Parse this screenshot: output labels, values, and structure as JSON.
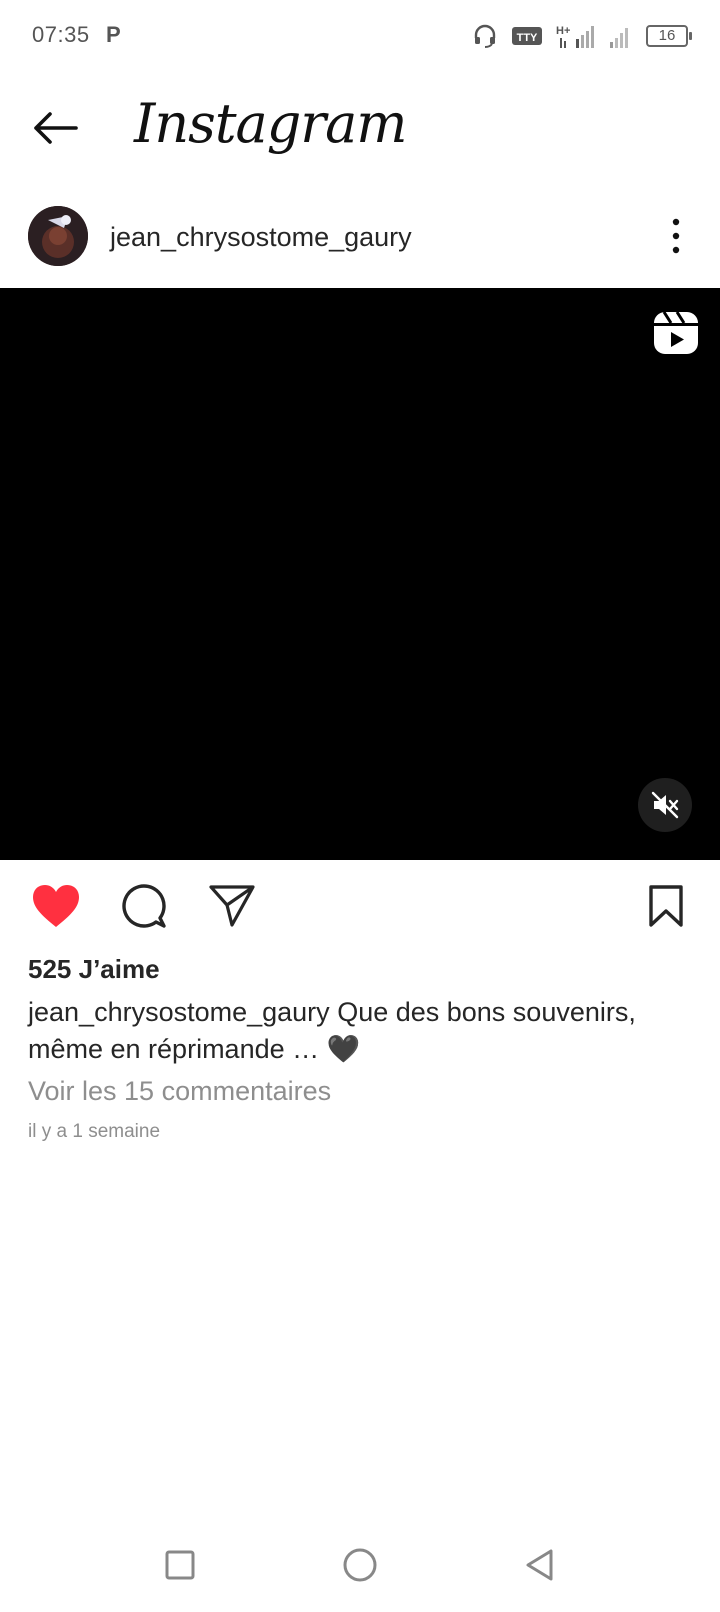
{
  "status_bar": {
    "time": "07:35",
    "notif_letter": "P",
    "tty_label": "TTY",
    "network_label": "H+",
    "battery_level": "16"
  },
  "header": {
    "app_title": "Instagram",
    "back_icon": "arrow-left-icon"
  },
  "post": {
    "username": "jean_chrysostome_gaury",
    "more_icon": "more-vertical-icon",
    "media": {
      "reel_icon": "reels-icon",
      "mute_icon": "speaker-muted-icon",
      "background": "#000000"
    },
    "actions": {
      "like_icon": "heart-filled-icon",
      "comment_icon": "comment-icon",
      "share_icon": "send-icon",
      "save_icon": "bookmark-icon",
      "liked": true,
      "like_color": "#ff3040"
    },
    "likes_text": "525 J’aime",
    "caption_user": "jean_chrysostome_gaury",
    "caption_text": "Que des bons souvenirs, même en réprimande … 🖤",
    "view_comments": "Voir les 15 commentaires",
    "timestamp": "il y a 1 semaine"
  },
  "nav_bar": {
    "recent_icon": "square-icon",
    "home_icon": "circle-icon",
    "back_icon": "triangle-back-icon"
  }
}
